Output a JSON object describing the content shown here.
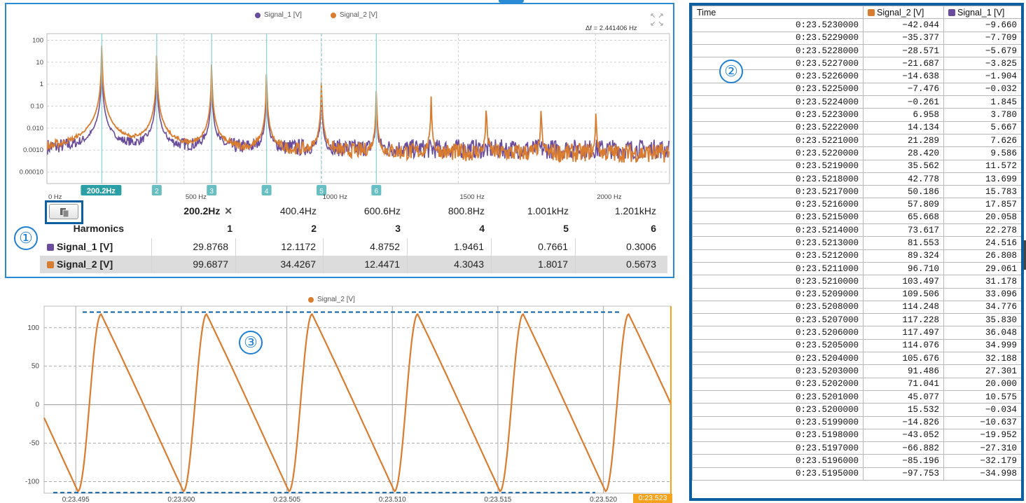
{
  "colors": {
    "signal_1": "#6a4c9c",
    "signal_2": "#d97c2f",
    "accent_blue": "#0e5fa0",
    "cursor_teal": "#2aa0a6",
    "time_highlight": "#f5a21c"
  },
  "fft": {
    "legend": [
      {
        "label": "Signal_1 [V]",
        "color": "#6a4c9c"
      },
      {
        "label": "Signal_2 [V]",
        "color": "#d97c2f"
      }
    ],
    "df_label": "Δf = 2.441406 Hz",
    "expand_icon": "expand-icon",
    "y_ticks": [
      "100",
      "10",
      "1",
      "0.10",
      "0.010",
      "0.0010",
      "0.00010"
    ],
    "x_ticks": [
      "0 Hz",
      "500 Hz",
      "1000 Hz",
      "1500 Hz",
      "2000 Hz"
    ],
    "cursor_main_label": "200.2Hz",
    "cursor_markers": [
      "2",
      "3",
      "4",
      "5",
      "6"
    ],
    "harmonics": {
      "copy_icon": "copy-icon",
      "freq_headers": [
        "200.2Hz",
        "400.4Hz",
        "600.6Hz",
        "800.8Hz",
        "1.001kHz",
        "1.201kHz"
      ],
      "close_glyph": "✕",
      "title": "Harmonics",
      "orders": [
        "1",
        "2",
        "3",
        "4",
        "5",
        "6"
      ],
      "rows": [
        {
          "name": "Signal_1 [V]",
          "color": "#6a4c9c",
          "values": [
            "29.8768",
            "12.1172",
            "4.8752",
            "1.9461",
            "0.7661",
            "0.3006"
          ]
        },
        {
          "name": "Signal_2 [V]",
          "color": "#d97c2f",
          "values": [
            "99.6877",
            "34.4267",
            "12.4471",
            "4.3043",
            "1.8017",
            "0.5673"
          ]
        }
      ]
    },
    "chart_data": {
      "type": "line",
      "x_unit": "Hz",
      "y_scale": "log",
      "xlim": [
        0,
        2270
      ],
      "ylim": [
        3e-05,
        200
      ],
      "series": [
        {
          "name": "Signal_1 [V]",
          "peaks_hz": [
            200.2,
            400.4,
            600.6,
            800.8,
            1001,
            1201
          ],
          "peak_values": [
            29.8768,
            12.1172,
            4.8752,
            1.9461,
            0.7661,
            0.3006
          ]
        },
        {
          "name": "Signal_2 [V]",
          "peaks_hz": [
            200.2,
            400.4,
            600.6,
            800.8,
            1001,
            1201,
            1401,
            1602,
            1802,
            2002
          ],
          "peak_values": [
            99.6877,
            34.4267,
            12.4471,
            4.3043,
            1.8017,
            0.5673,
            0.28,
            0.14,
            0.1,
            0.06
          ]
        }
      ]
    }
  },
  "annotations": {
    "c1": "①",
    "c2": "②",
    "c3": "③"
  },
  "table": {
    "headers": {
      "time": "Time",
      "s2": "Signal_2 [V]",
      "s1": "Signal_1 [V]"
    },
    "rows": [
      [
        "0:23.5230000",
        "−42.044",
        "−9.660"
      ],
      [
        "0:23.5229000",
        "−35.377",
        "−7.709"
      ],
      [
        "0:23.5228000",
        "−28.571",
        "−5.679"
      ],
      [
        "0:23.5227000",
        "−21.687",
        "−3.825"
      ],
      [
        "0:23.5226000",
        "−14.638",
        "−1.904"
      ],
      [
        "0:23.5225000",
        "−7.476",
        "−0.032"
      ],
      [
        "0:23.5224000",
        "−0.261",
        "1.845"
      ],
      [
        "0:23.5223000",
        "6.958",
        "3.780"
      ],
      [
        "0:23.5222000",
        "14.134",
        "5.667"
      ],
      [
        "0:23.5221000",
        "21.289",
        "7.626"
      ],
      [
        "0:23.5220000",
        "28.420",
        "9.586"
      ],
      [
        "0:23.5219000",
        "35.562",
        "11.572"
      ],
      [
        "0:23.5218000",
        "42.778",
        "13.699"
      ],
      [
        "0:23.5217000",
        "50.186",
        "15.783"
      ],
      [
        "0:23.5216000",
        "57.809",
        "17.857"
      ],
      [
        "0:23.5215000",
        "65.668",
        "20.058"
      ],
      [
        "0:23.5214000",
        "73.617",
        "22.278"
      ],
      [
        "0:23.5213000",
        "81.553",
        "24.516"
      ],
      [
        "0:23.5212000",
        "89.324",
        "26.808"
      ],
      [
        "0:23.5211000",
        "96.710",
        "29.061"
      ],
      [
        "0:23.5210000",
        "103.497",
        "31.178"
      ],
      [
        "0:23.5209000",
        "109.506",
        "33.096"
      ],
      [
        "0:23.5208000",
        "114.248",
        "34.776"
      ],
      [
        "0:23.5207000",
        "117.228",
        "35.830"
      ],
      [
        "0:23.5206000",
        "117.497",
        "36.048"
      ],
      [
        "0:23.5205000",
        "114.076",
        "34.999"
      ],
      [
        "0:23.5204000",
        "105.676",
        "32.188"
      ],
      [
        "0:23.5203000",
        "91.486",
        "27.301"
      ],
      [
        "0:23.5202000",
        "71.041",
        "20.000"
      ],
      [
        "0:23.5201000",
        "45.077",
        "10.575"
      ],
      [
        "0:23.5200000",
        "15.532",
        "−0.034"
      ],
      [
        "0:23.5199000",
        "−14.826",
        "−10.637"
      ],
      [
        "0:23.5198000",
        "−43.052",
        "−19.952"
      ],
      [
        "0:23.5197000",
        "−66.882",
        "−27.310"
      ],
      [
        "0:23.5196000",
        "−85.196",
        "−32.179"
      ],
      [
        "0:23.5195000",
        "−97.753",
        "−34.998"
      ]
    ]
  },
  "time_chart": {
    "legend": {
      "label": "Signal_2 [V]",
      "color": "#d97c2f"
    },
    "y_ticks": [
      "100",
      "50",
      "0",
      "-50",
      "-100"
    ],
    "x_ticks": [
      "0:23.495",
      "0:23.500",
      "0:23.505",
      "0:23.510",
      "0:23.515",
      "0:23.520"
    ],
    "cursor_label": "0:23.523",
    "chart_data": {
      "type": "line",
      "x_unit": "s",
      "xlim": [
        23.4935,
        23.5232
      ],
      "ylim": [
        -115,
        128
      ],
      "series": [
        {
          "name": "Signal_2 [V]",
          "period_s": 0.005,
          "peak": 117.5,
          "trough": -112.5
        }
      ]
    }
  }
}
